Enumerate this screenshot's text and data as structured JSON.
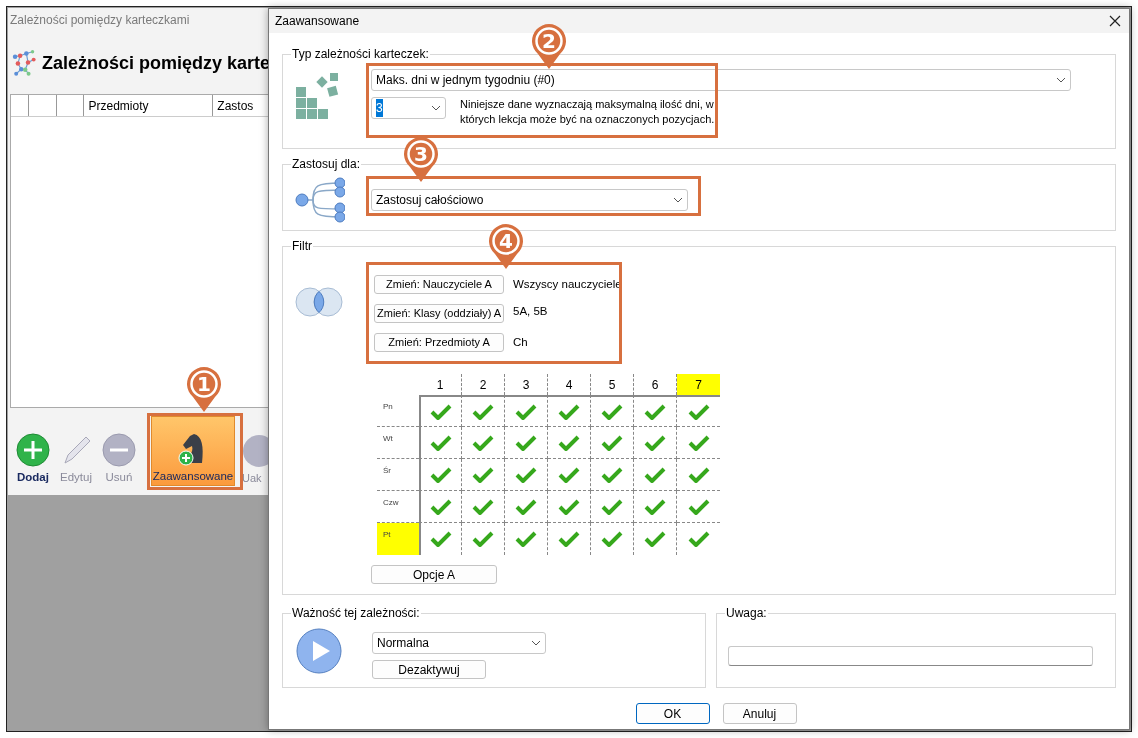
{
  "main_window": {
    "title": "Zależności pomiędzy karteczkami",
    "heading": "Zależności pomiędzy karte",
    "table": {
      "columns": [
        "Przedmioty",
        "Zastos"
      ]
    },
    "toolbar": [
      {
        "label": "Dodaj",
        "kind": "add",
        "disabled": false,
        "selected": false
      },
      {
        "label": "Edytuj",
        "kind": "edit",
        "disabled": true,
        "selected": false
      },
      {
        "label": "Usuń",
        "kind": "remove",
        "disabled": true,
        "selected": false
      },
      {
        "label": "Zaawansowane",
        "kind": "advanced",
        "disabled": false,
        "selected": true
      },
      {
        "label": "Uak",
        "kind": "other",
        "disabled": true,
        "selected": false
      }
    ]
  },
  "dialog": {
    "title": "Zaawansowane",
    "type_group": {
      "legend": "Typ zależności karteczek:",
      "type_select": "Maks. dni w jednym tygodniu (#0)",
      "count_select": "3",
      "description": "Niniejsze dane wyznaczają maksymalną ilość dni, w których lekcja może być na oznaczonych pozycjach."
    },
    "apply_group": {
      "legend": "Zastosuj dla:",
      "apply_select": "Zastosuj całościowo"
    },
    "filter_group": {
      "legend": "Filtr",
      "filters": [
        {
          "button": "Zmień: Nauczyciele A",
          "value": "Wszyscy nauczyciele"
        },
        {
          "button": "Zmień: Klasy (oddziały) A",
          "value": "5A, 5B"
        },
        {
          "button": "Zmień: Przedmioty A",
          "value": "Ch"
        }
      ],
      "grid": {
        "columns": [
          {
            "label": "1",
            "highlighted": false
          },
          {
            "label": "2",
            "highlighted": false
          },
          {
            "label": "3",
            "highlighted": false
          },
          {
            "label": "4",
            "highlighted": false
          },
          {
            "label": "5",
            "highlighted": false
          },
          {
            "label": "6",
            "highlighted": false
          },
          {
            "label": "7",
            "highlighted": true
          }
        ],
        "rows": [
          {
            "label": "Pn",
            "highlighted": false,
            "cells": [
              {
                "checked": true
              },
              {
                "checked": true
              },
              {
                "checked": true
              },
              {
                "checked": true
              },
              {
                "checked": true
              },
              {
                "checked": true
              },
              {
                "checked": true
              }
            ]
          },
          {
            "label": "Wt",
            "highlighted": false,
            "cells": [
              {
                "checked": true
              },
              {
                "checked": true
              },
              {
                "checked": true
              },
              {
                "checked": true
              },
              {
                "checked": true
              },
              {
                "checked": true
              },
              {
                "checked": true
              }
            ]
          },
          {
            "label": "Śr",
            "highlighted": false,
            "cells": [
              {
                "checked": true
              },
              {
                "checked": true
              },
              {
                "checked": true
              },
              {
                "checked": true
              },
              {
                "checked": true
              },
              {
                "checked": true
              },
              {
                "checked": true
              }
            ]
          },
          {
            "label": "Czw",
            "highlighted": false,
            "cells": [
              {
                "checked": true
              },
              {
                "checked": true
              },
              {
                "checked": true
              },
              {
                "checked": true
              },
              {
                "checked": true
              },
              {
                "checked": true
              },
              {
                "checked": true
              }
            ]
          },
          {
            "label": "Pt",
            "highlighted": true,
            "cells": [
              {
                "checked": true
              },
              {
                "checked": true
              },
              {
                "checked": true
              },
              {
                "checked": true
              },
              {
                "checked": true
              },
              {
                "checked": true
              },
              {
                "checked": true
              }
            ]
          }
        ]
      },
      "options_button": "Opcje A"
    },
    "importance_group": {
      "legend": "Ważność tej zależności:",
      "importance_select": "Normalna",
      "deactivate_button": "Dezaktywuj"
    },
    "note_group": {
      "legend": "Uwaga:"
    },
    "buttons": [
      {
        "label": "OK",
        "default": true
      },
      {
        "label": "Anuluj",
        "default": false
      }
    ]
  },
  "annotations": [
    {
      "number": "1"
    },
    {
      "number": "2"
    },
    {
      "number": "3"
    },
    {
      "number": "4"
    }
  ]
}
